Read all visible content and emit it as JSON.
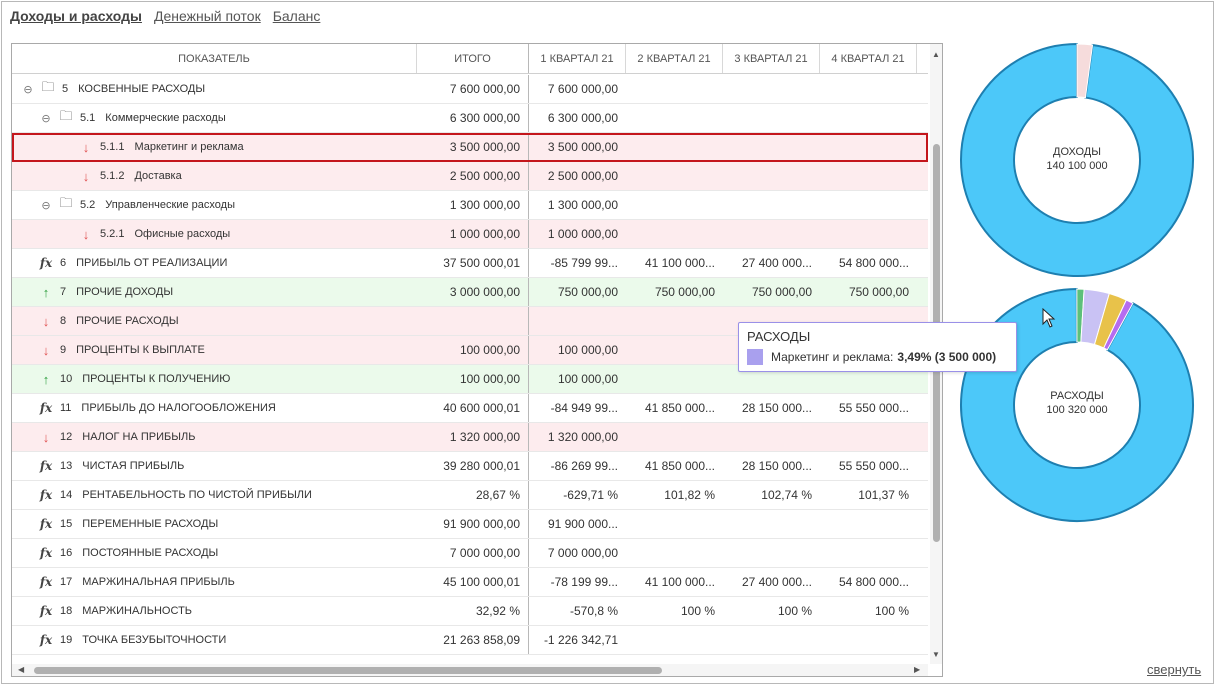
{
  "tabs": [
    {
      "label": "Доходы и расходы",
      "active": true
    },
    {
      "label": "Денежный поток",
      "active": false
    },
    {
      "label": "Баланс",
      "active": false
    }
  ],
  "table": {
    "headers": [
      "ПОКАЗАТЕЛЬ",
      "ИТОГО",
      "1 КВАРТАЛ 21",
      "2 КВАРТАЛ 21",
      "3 КВАРТАЛ 21",
      "4 КВАРТАЛ 21"
    ],
    "rows": [
      {
        "code": "5",
        "name": "КОСВЕННЫЕ РАСХОДЫ",
        "icon": "folder-sum-icon",
        "level": 0,
        "bg": "white",
        "collapse": true,
        "values": [
          "7 600 000,00",
          "7 600 000,00",
          "",
          "",
          ""
        ]
      },
      {
        "code": "5.1",
        "name": "Коммерческие расходы",
        "icon": "folder-sum-icon",
        "level": 1,
        "bg": "white",
        "collapse": true,
        "values": [
          "6 300 000,00",
          "6 300 000,00",
          "",
          "",
          ""
        ]
      },
      {
        "code": "5.1.1",
        "name": "Маркетинг и реклама",
        "icon": "arrow-down-icon",
        "level": 2,
        "bg": "red",
        "selected": true,
        "values": [
          "3 500 000,00",
          "3 500 000,00",
          "",
          "",
          ""
        ]
      },
      {
        "code": "5.1.2",
        "name": "Доставка",
        "icon": "arrow-down-icon",
        "level": 2,
        "bg": "red",
        "values": [
          "2 500 000,00",
          "2 500 000,00",
          "",
          "",
          ""
        ]
      },
      {
        "code": "5.2",
        "name": "Управленческие расходы",
        "icon": "folder-sum-icon",
        "level": 1,
        "bg": "white",
        "collapse": true,
        "values": [
          "1 300 000,00",
          "1 300 000,00",
          "",
          "",
          ""
        ]
      },
      {
        "code": "5.2.1",
        "name": "Офисные расходы",
        "icon": "arrow-down-icon",
        "level": 2,
        "bg": "red",
        "values": [
          "1 000 000,00",
          "1 000 000,00",
          "",
          "",
          ""
        ]
      },
      {
        "code": "6",
        "name": "ПРИБЫЛЬ ОТ РЕАЛИЗАЦИИ",
        "icon": "fx-icon",
        "level": 0,
        "bg": "white",
        "values": [
          "37 500 000,01",
          "-85 799 99...",
          "41 100 000...",
          "27 400 000...",
          "54 800 000..."
        ]
      },
      {
        "code": "7",
        "name": "ПРОЧИЕ ДОХОДЫ",
        "icon": "arrow-up-icon",
        "level": 0,
        "bg": "green",
        "values": [
          "3 000 000,00",
          "750 000,00",
          "750 000,00",
          "750 000,00",
          "750 000,00"
        ]
      },
      {
        "code": "8",
        "name": "ПРОЧИЕ РАСХОДЫ",
        "icon": "arrow-down-icon",
        "level": 0,
        "bg": "red",
        "values": [
          "",
          "",
          "",
          "",
          ""
        ]
      },
      {
        "code": "9",
        "name": "ПРОЦЕНТЫ К ВЫПЛАТЕ",
        "icon": "arrow-down-icon",
        "level": 0,
        "bg": "red",
        "values": [
          "100 000,00",
          "100 000,00",
          "",
          "",
          ""
        ]
      },
      {
        "code": "10",
        "name": "ПРОЦЕНТЫ К ПОЛУЧЕНИЮ",
        "icon": "arrow-up-icon",
        "level": 0,
        "bg": "green",
        "values": [
          "100 000,00",
          "100 000,00",
          "",
          "",
          ""
        ]
      },
      {
        "code": "11",
        "name": "ПРИБЫЛЬ ДО НАЛОГООБЛОЖЕНИЯ",
        "icon": "fx-icon",
        "level": 0,
        "bg": "white",
        "values": [
          "40 600 000,01",
          "-84 949 99...",
          "41 850 000...",
          "28 150 000...",
          "55 550 000..."
        ]
      },
      {
        "code": "12",
        "name": "НАЛОГ НА ПРИБЫЛЬ",
        "icon": "arrow-down-icon",
        "level": 0,
        "bg": "red",
        "values": [
          "1 320 000,00",
          "1 320 000,00",
          "",
          "",
          ""
        ]
      },
      {
        "code": "13",
        "name": "ЧИСТАЯ ПРИБЫЛЬ",
        "icon": "fx-icon",
        "level": 0,
        "bg": "white",
        "values": [
          "39 280 000,01",
          "-86 269 99...",
          "41 850 000...",
          "28 150 000...",
          "55 550 000..."
        ]
      },
      {
        "code": "14",
        "name": "РЕНТАБЕЛЬНОСТЬ ПО ЧИСТОЙ ПРИБЫЛИ",
        "icon": "fx-icon",
        "level": 0,
        "bg": "white",
        "values": [
          "28,67 %",
          "-629,71 %",
          "101,82 %",
          "102,74 %",
          "101,37 %"
        ]
      },
      {
        "code": "15",
        "name": "ПЕРЕМЕННЫЕ РАСХОДЫ",
        "icon": "fx-icon",
        "level": 0,
        "bg": "white",
        "values": [
          "91 900 000,00",
          "91 900 000...",
          "",
          "",
          ""
        ]
      },
      {
        "code": "16",
        "name": "ПОСТОЯННЫЕ РАСХОДЫ",
        "icon": "fx-icon",
        "level": 0,
        "bg": "white",
        "values": [
          "7 000 000,00",
          "7 000 000,00",
          "",
          "",
          ""
        ]
      },
      {
        "code": "17",
        "name": "МАРЖИНАЛЬНАЯ ПРИБЫЛЬ",
        "icon": "fx-icon",
        "level": 0,
        "bg": "white",
        "values": [
          "45 100 000,01",
          "-78 199 99...",
          "41 100 000...",
          "27 400 000...",
          "54 800 000..."
        ]
      },
      {
        "code": "18",
        "name": "МАРЖИНАЛЬНОСТЬ",
        "icon": "fx-icon",
        "level": 0,
        "bg": "white",
        "values": [
          "32,92 %",
          "-570,8 %",
          "100 %",
          "100 %",
          "100 %"
        ]
      },
      {
        "code": "19",
        "name": "ТОЧКА БЕЗУБЫТОЧНОСТИ",
        "icon": "fx-icon",
        "level": 0,
        "bg": "white",
        "values": [
          "21 263 858,09",
          "-1 226 342,71",
          "",
          "",
          ""
        ]
      }
    ]
  },
  "income_donut": {
    "label": "ДОХОДЫ",
    "total": "140 100 000",
    "slices": [
      {
        "value": 97.86,
        "color": "#4cc8f9"
      },
      {
        "value": 2.14,
        "color": "#f6dcdc"
      }
    ]
  },
  "expense_donut": {
    "label": "РАСХОДЫ",
    "total": "100 320 000",
    "slices": [
      {
        "value": 91.6,
        "color": "#4cc8f9"
      },
      {
        "value": 1.0,
        "color": "#5cc07a"
      },
      {
        "value": 3.49,
        "color": "#c9c2f4"
      },
      {
        "value": 2.49,
        "color": "#e8c24a"
      },
      {
        "value": 1.0,
        "color": "#b56cf0"
      }
    ]
  },
  "tooltip": {
    "title": "РАСХОДЫ",
    "item": "Маркетинг и реклама:",
    "value": "3,49% (3 500 000)"
  },
  "collapse_link": "свернуть"
}
